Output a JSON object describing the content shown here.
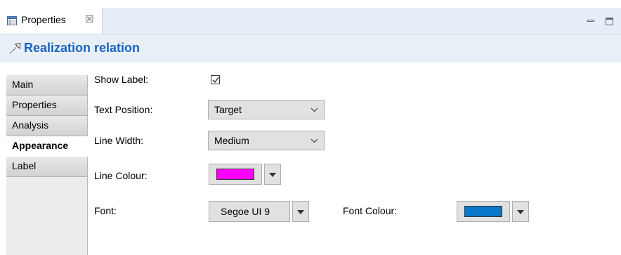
{
  "view_tab": {
    "label": "Properties",
    "close": "☒"
  },
  "header": {
    "title": "Realization relation"
  },
  "sidebar": {
    "items": [
      {
        "label": "Main",
        "active": false
      },
      {
        "label": "Properties",
        "active": false
      },
      {
        "label": "Analysis",
        "active": false
      },
      {
        "label": "Appearance",
        "active": true
      },
      {
        "label": "Label",
        "active": false
      }
    ]
  },
  "form": {
    "show_label": {
      "label": "Show Label:",
      "checked": true
    },
    "text_position": {
      "label": "Text Position:",
      "value": "Target"
    },
    "line_width": {
      "label": "Line Width:",
      "value": "Medium"
    },
    "line_colour": {
      "label": "Line Colour:",
      "color": "#ff00ff"
    },
    "font": {
      "label": "Font:",
      "value": "Segoe UI 9"
    },
    "font_colour": {
      "label": "Font Colour:",
      "color": "#0a78c8"
    }
  },
  "colors": {
    "accent": "#1864c2",
    "header_bg": "#e9eff7"
  },
  "icons": [
    "properties-view-icon",
    "realization-relation-icon",
    "minimize-icon",
    "maximize-icon",
    "chevron-down-icon",
    "dropdown-arrow-icon",
    "checkmark-icon"
  ]
}
